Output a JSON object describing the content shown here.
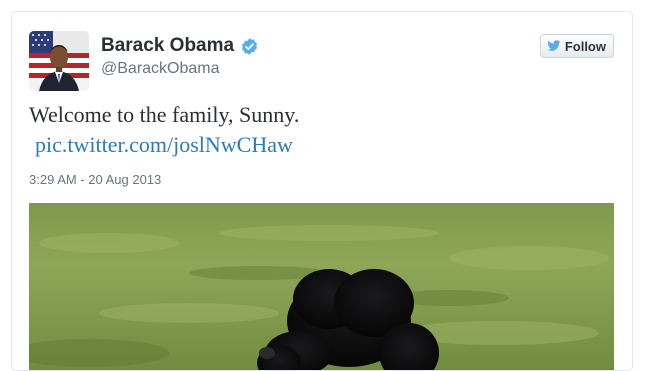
{
  "tweet": {
    "author": {
      "name": "Barack Obama",
      "handle": "@BarackObama",
      "verified": true
    },
    "text": "Welcome to the family, Sunny.",
    "link": "pic.twitter.com/joslNwCHaw",
    "timestamp": "3:29 AM - 20 Aug 2013"
  },
  "follow_button": {
    "label": "Follow"
  },
  "icons": {
    "verified": "verified-badge-icon",
    "follow": "twitter-bird-icon"
  },
  "colors": {
    "link": "#2b7bb9",
    "verified": "#55acee",
    "name": "#292f33",
    "muted": "#66757f"
  }
}
